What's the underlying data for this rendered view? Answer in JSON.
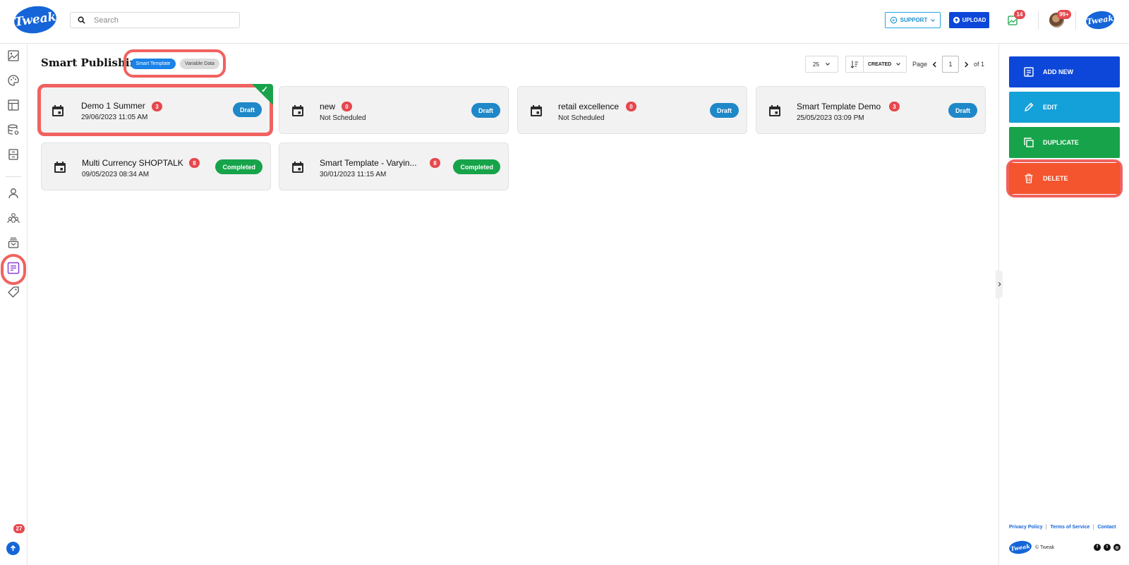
{
  "app": {
    "logo_text": "Tweak"
  },
  "topbar": {
    "search_placeholder": "Search",
    "support_label": "SUPPORT",
    "upload_label": "UPLOAD",
    "images_badge": "14",
    "notifications_badge": "99+"
  },
  "leftnav": {
    "items": [
      "image-library-icon",
      "palette-icon",
      "layout-icon",
      "database-settings-icon",
      "archive-icon",
      "user-icon",
      "team-icon",
      "inbox-stack-icon",
      "smart-publishing-icon",
      "tag-icon"
    ],
    "active": "smart-publishing-icon",
    "updates_badge": "27"
  },
  "main": {
    "title": "Smart Publishing",
    "modes": [
      "Smart Template",
      "Variable Data"
    ],
    "active_mode": "Smart Template",
    "per_page": "25",
    "sort_label": "CREATED",
    "pager": {
      "page_label": "Page",
      "current": "1",
      "of_label": "of 1"
    },
    "cards": [
      {
        "name": "Demo 1 Summer",
        "count": "3",
        "date": "29/06/2023 11:05 AM",
        "status": "Draft",
        "selected": true
      },
      {
        "name": "new",
        "count": "0",
        "date": "Not Scheduled",
        "status": "Draft"
      },
      {
        "name": "retail excellence",
        "count": "0",
        "date": "Not Scheduled",
        "status": "Draft"
      },
      {
        "name": "Smart Template Demo",
        "count": "3",
        "date": "25/05/2023 03:09 PM",
        "status": "Draft"
      },
      {
        "name": "Multi Currency SHOPTALK",
        "count": "8",
        "date": "09/05/2023 08:34 AM",
        "status": "Completed"
      },
      {
        "name": "Smart Template - Varyin...",
        "count": "8",
        "date": "30/01/2023 11:15 AM",
        "status": "Completed"
      }
    ]
  },
  "actions": {
    "add_new": "ADD NEW",
    "edit": "EDIT",
    "duplicate": "DUPLICATE",
    "delete": "DELETE"
  },
  "footer": {
    "privacy": "Privacy Policy",
    "terms": "Terms of Service",
    "contact": "Contact",
    "copyright": "© Tweak",
    "social": [
      "facebook-icon",
      "twitter-icon",
      "instagram-icon"
    ]
  },
  "colors": {
    "brand_blue": "#1565d8",
    "draft_blue": "#1e88c8",
    "completed_green": "#17a34a",
    "delete_orange": "#f4542e",
    "highlight_red": "#f0625f",
    "badge_red": "#e5484d"
  }
}
